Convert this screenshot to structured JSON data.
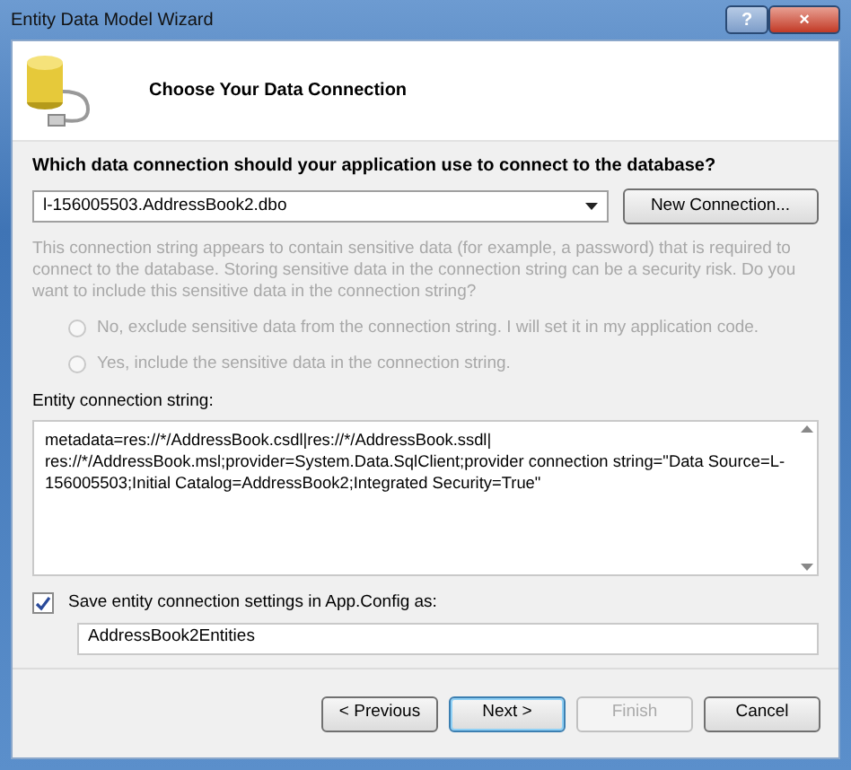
{
  "window": {
    "title": "Entity Data Model Wizard",
    "title_buttons": [
      {
        "kind": "help",
        "label": "?"
      },
      {
        "kind": "close",
        "label": "×"
      }
    ]
  },
  "header": {
    "title": "Choose Your Data Connection"
  },
  "question": "Which data connection should your application use to connect to the database?",
  "connection": {
    "value": "l-156005503.AddressBook2.dbo",
    "button": "New Connection..."
  },
  "sensitive": {
    "disabled": true,
    "text": "This connection string appears to contain sensitive data (for example, a password) that is required to connect to the database. Storing sensitive data in the connection string can be a security risk. Do you want to include this sensitive data in the connection string?",
    "options": [
      {
        "label": "No, exclude sensitive data from the connection string. I will set it in my application code.",
        "selected": false
      },
      {
        "label": "Yes, include the sensitive data in the connection string.",
        "selected": false
      }
    ]
  },
  "entity_connection": {
    "label": "Entity connection string:",
    "value": "metadata=res://*/AddressBook.csdl|res://*/AddressBook.ssdl|\nres://*/AddressBook.msl;provider=System.Data.SqlClient;provider connection string=\"Data Source=L-\n156005503;Initial Catalog=AddressBook2;Integrated Security=True\""
  },
  "save_settings": {
    "label": "Save entity connection settings in App.Config as:",
    "checked": true,
    "value": "AddressBook2Entities"
  },
  "buttons": [
    {
      "label": "< Previous",
      "disabled": false,
      "default": false
    },
    {
      "label": "Next >",
      "disabled": false,
      "default": true
    },
    {
      "label": "Finish",
      "disabled": true,
      "default": false
    },
    {
      "label": "Cancel",
      "disabled": false,
      "default": false
    }
  ]
}
